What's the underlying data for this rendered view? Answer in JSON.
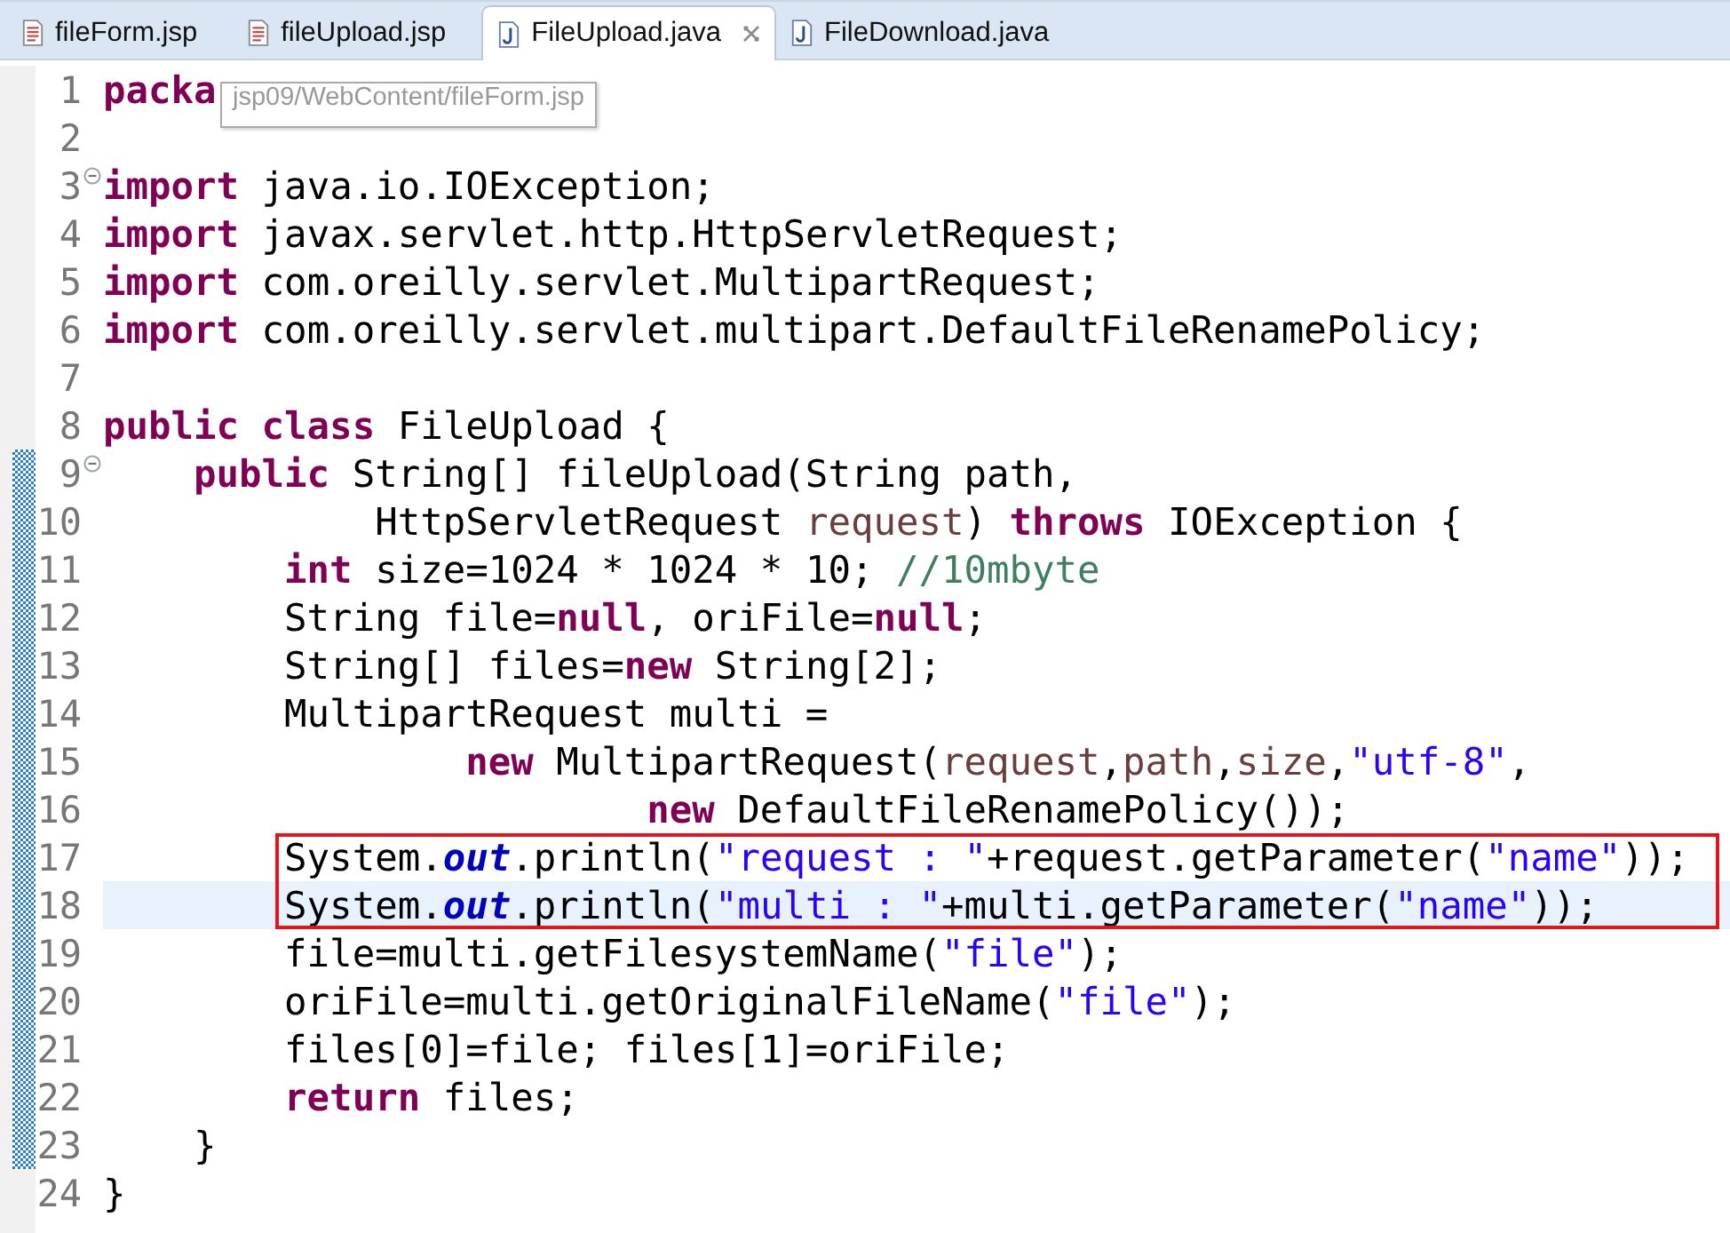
{
  "tabs": [
    {
      "label": "fileForm.jsp",
      "kind": "jsp",
      "selected": false,
      "closable": false
    },
    {
      "label": "fileUpload.jsp",
      "kind": "jsp",
      "selected": false,
      "closable": false
    },
    {
      "label": "FileUpload.java",
      "kind": "java",
      "selected": true,
      "closable": true
    },
    {
      "label": "FileDownload.java",
      "kind": "java",
      "selected": false,
      "closable": false
    }
  ],
  "tooltip": {
    "text": "jsp09/WebContent/fileForm.jsp"
  },
  "editor": {
    "lines": [
      {
        "number": "1",
        "fold": false,
        "marked": false,
        "current": false,
        "boxed": false,
        "tokens": [
          {
            "kind": "kw",
            "text": "packa"
          }
        ]
      },
      {
        "number": "2",
        "fold": false,
        "marked": false,
        "current": false,
        "boxed": false
      },
      {
        "number": "3",
        "fold": true,
        "marked": false,
        "current": false,
        "boxed": false,
        "tokens": [
          {
            "kind": "kw",
            "text": "import"
          },
          {
            "kind": "plain",
            "text": " java.io.IOException;"
          }
        ]
      },
      {
        "number": "4",
        "fold": false,
        "marked": false,
        "current": false,
        "boxed": false,
        "tokens": [
          {
            "kind": "kw",
            "text": "import"
          },
          {
            "kind": "plain",
            "text": " javax.servlet.http.HttpServletRequest;"
          }
        ]
      },
      {
        "number": "5",
        "fold": false,
        "marked": false,
        "current": false,
        "boxed": false,
        "tokens": [
          {
            "kind": "kw",
            "text": "import"
          },
          {
            "kind": "plain",
            "text": " com.oreilly.servlet.MultipartRequest;"
          }
        ]
      },
      {
        "number": "6",
        "fold": false,
        "marked": false,
        "current": false,
        "boxed": false,
        "tokens": [
          {
            "kind": "kw",
            "text": "import"
          },
          {
            "kind": "plain",
            "text": " com.oreilly.servlet.multipart.DefaultFileRenamePolicy;"
          }
        ]
      },
      {
        "number": "7",
        "fold": false,
        "marked": false,
        "current": false,
        "boxed": false
      },
      {
        "number": "8",
        "fold": false,
        "marked": false,
        "current": false,
        "boxed": false,
        "tokens": [
          {
            "kind": "kw",
            "text": "public class"
          },
          {
            "kind": "plain",
            "text": " FileUpload {"
          }
        ]
      },
      {
        "number": "9",
        "fold": true,
        "marked": true,
        "current": false,
        "boxed": false,
        "tokens": [
          {
            "kind": "kw",
            "text": "    public"
          },
          {
            "kind": "plain",
            "text": " String[] fileUpload(String path,"
          }
        ]
      },
      {
        "number": "10",
        "fold": false,
        "marked": true,
        "current": false,
        "boxed": false,
        "tokens": [
          {
            "kind": "plain",
            "text": "            HttpServletRequest "
          },
          {
            "kind": "var",
            "text": "request"
          },
          {
            "kind": "plain",
            "text": ") "
          },
          {
            "kind": "kw",
            "text": "throws"
          },
          {
            "kind": "plain",
            "text": " IOException {"
          }
        ]
      },
      {
        "number": "11",
        "fold": false,
        "marked": true,
        "current": false,
        "boxed": false,
        "tokens": [
          {
            "kind": "kw",
            "text": "        int"
          },
          {
            "kind": "plain",
            "text": " size=1024 * 1024 * 10; "
          },
          {
            "kind": "comment",
            "text": "//10mbyte"
          }
        ]
      },
      {
        "number": "12",
        "fold": false,
        "marked": true,
        "current": false,
        "boxed": false,
        "tokens": [
          {
            "kind": "plain",
            "text": "        String file="
          },
          {
            "kind": "kw",
            "text": "null"
          },
          {
            "kind": "plain",
            "text": ", oriFile="
          },
          {
            "kind": "kw",
            "text": "null"
          },
          {
            "kind": "plain",
            "text": ";"
          }
        ]
      },
      {
        "number": "13",
        "fold": false,
        "marked": true,
        "current": false,
        "boxed": false,
        "tokens": [
          {
            "kind": "plain",
            "text": "        String[] files="
          },
          {
            "kind": "kw",
            "text": "new"
          },
          {
            "kind": "plain",
            "text": " String[2];"
          }
        ]
      },
      {
        "number": "14",
        "fold": false,
        "marked": true,
        "current": false,
        "boxed": false,
        "tokens": [
          {
            "kind": "plain",
            "text": "        MultipartRequest multi ="
          }
        ]
      },
      {
        "number": "15",
        "fold": false,
        "marked": true,
        "current": false,
        "boxed": false,
        "tokens": [
          {
            "kind": "kw",
            "text": "                new"
          },
          {
            "kind": "plain",
            "text": " MultipartRequest("
          },
          {
            "kind": "var",
            "text": "request"
          },
          {
            "kind": "plain",
            "text": ","
          },
          {
            "kind": "var",
            "text": "path"
          },
          {
            "kind": "plain",
            "text": ","
          },
          {
            "kind": "var",
            "text": "size"
          },
          {
            "kind": "plain",
            "text": ","
          },
          {
            "kind": "string",
            "text": "\"utf-8\""
          },
          {
            "kind": "plain",
            "text": ","
          }
        ]
      },
      {
        "number": "16",
        "fold": false,
        "marked": true,
        "current": false,
        "boxed": false,
        "tokens": [
          {
            "kind": "kw",
            "text": "                        new"
          },
          {
            "kind": "plain",
            "text": " DefaultFileRenamePolicy());"
          }
        ]
      },
      {
        "number": "17",
        "fold": false,
        "marked": true,
        "current": false,
        "boxed": true,
        "tokens": [
          {
            "kind": "plain",
            "text": "        System."
          },
          {
            "kind": "field",
            "text": "out"
          },
          {
            "kind": "plain",
            "text": ".println("
          },
          {
            "kind": "string",
            "text": "\"request : \""
          },
          {
            "kind": "plain",
            "text": "+request.getParameter("
          },
          {
            "kind": "string",
            "text": "\"name\""
          },
          {
            "kind": "plain",
            "text": "));"
          }
        ]
      },
      {
        "number": "18",
        "fold": false,
        "marked": true,
        "current": true,
        "boxed": true,
        "tokens": [
          {
            "kind": "plain",
            "text": "        System."
          },
          {
            "kind": "field",
            "text": "out"
          },
          {
            "kind": "plain",
            "text": ".println("
          },
          {
            "kind": "string",
            "text": "\"multi : \""
          },
          {
            "kind": "plain",
            "text": "+multi.getParameter("
          },
          {
            "kind": "string",
            "text": "\"name\""
          },
          {
            "kind": "plain",
            "text": "));"
          }
        ]
      },
      {
        "number": "19",
        "fold": false,
        "marked": true,
        "current": false,
        "boxed": false,
        "tokens": [
          {
            "kind": "plain",
            "text": "        file=multi.getFilesystemName("
          },
          {
            "kind": "string",
            "text": "\"file\""
          },
          {
            "kind": "plain",
            "text": ");"
          }
        ]
      },
      {
        "number": "20",
        "fold": false,
        "marked": true,
        "current": false,
        "boxed": false,
        "tokens": [
          {
            "kind": "plain",
            "text": "        oriFile=multi.getOriginalFileName("
          },
          {
            "kind": "string",
            "text": "\"file\""
          },
          {
            "kind": "plain",
            "text": ");"
          }
        ]
      },
      {
        "number": "21",
        "fold": false,
        "marked": true,
        "current": false,
        "boxed": false,
        "tokens": [
          {
            "kind": "plain",
            "text": "        files[0]=file; files[1]=oriFile;"
          }
        ]
      },
      {
        "number": "22",
        "fold": false,
        "marked": true,
        "current": false,
        "boxed": false,
        "tokens": [
          {
            "kind": "kw",
            "text": "        return"
          },
          {
            "kind": "plain",
            "text": " files;"
          }
        ]
      },
      {
        "number": "23",
        "fold": false,
        "marked": true,
        "current": false,
        "boxed": false,
        "tokens": [
          {
            "kind": "plain",
            "text": "    }"
          }
        ]
      },
      {
        "number": "24",
        "fold": false,
        "marked": false,
        "current": false,
        "boxed": false,
        "tokens": [
          {
            "kind": "plain",
            "text": "}"
          }
        ]
      }
    ]
  }
}
